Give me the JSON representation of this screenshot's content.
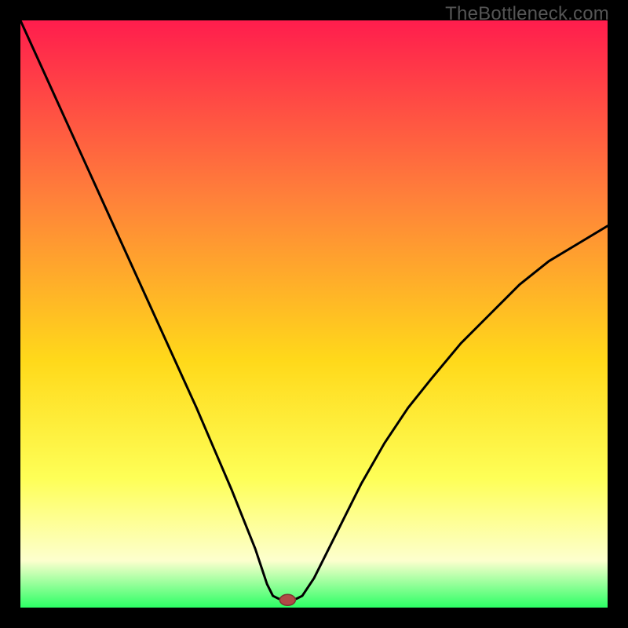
{
  "watermark": "TheBottleneck.com",
  "chart_data": {
    "type": "line",
    "title": "",
    "xlabel": "",
    "ylabel": "",
    "xlim": [
      0,
      100
    ],
    "ylim": [
      0,
      100
    ],
    "x": [
      0,
      5,
      10,
      15,
      20,
      25,
      30,
      33,
      36,
      38,
      40,
      41,
      42,
      43,
      44,
      45,
      46,
      47,
      48,
      50,
      52,
      55,
      58,
      62,
      66,
      70,
      75,
      80,
      85,
      90,
      95,
      100
    ],
    "y": [
      100,
      89,
      78,
      67,
      56,
      45,
      34,
      27,
      20,
      15,
      10,
      7,
      4,
      2,
      1.5,
      1.3,
      1.3,
      1.5,
      2,
      5,
      9,
      15,
      21,
      28,
      34,
      39,
      45,
      50,
      55,
      59,
      62,
      65
    ],
    "marker": {
      "x": 45.5,
      "y": 1.3
    },
    "bottom_band_start": 80
  },
  "colors": {
    "frame": "#000000",
    "watermark": "#555555",
    "gradient_top": "#ff1d4d",
    "gradient_mid1": "#ff803a",
    "gradient_mid2": "#ffd91a",
    "gradient_mid3": "#feff57",
    "gradient_bottom_pale": "#fdffce",
    "gradient_green": "#2cff65",
    "curve": "#000000",
    "marker_fill": "#b04a47",
    "marker_stroke": "#7c3631"
  }
}
